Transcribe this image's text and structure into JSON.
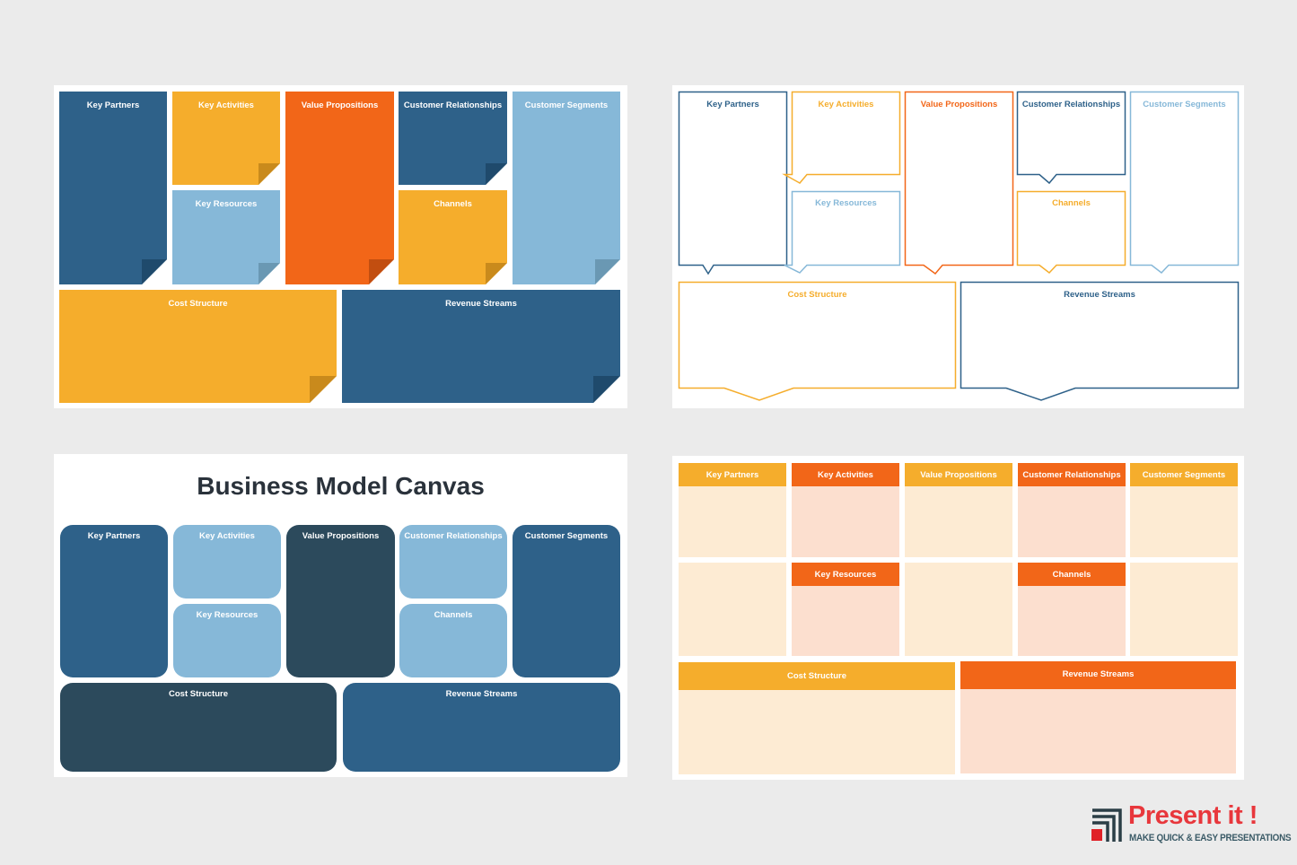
{
  "colors": {
    "dark_blue": "#2e6189",
    "light_blue": "#86b8d8",
    "orange": "#f26618",
    "yellow": "#f5ad2c",
    "navy": "#2c4a5c",
    "peach": "#fdebd3",
    "salmon": "#fcdfcf",
    "background": "#ebebeb",
    "logo_red": "#e8373c",
    "logo_dark": "#2b3e46"
  },
  "labels": {
    "key_partners": "Key Partners",
    "key_activities": "Key Activities",
    "key_resources": "Key Resources",
    "value_propositions": "Value Propositions",
    "customer_relationships": "Customer Relationships",
    "channels": "Channels",
    "customer_segments": "Customer Segments",
    "cost_structure": "Cost Structure",
    "revenue_streams": "Revenue Streams"
  },
  "slide3": {
    "title": "Business Model Canvas"
  },
  "logo": {
    "brand": "Present it !",
    "tagline": "MAKE QUICK & EASY PRESENTATIONS"
  }
}
